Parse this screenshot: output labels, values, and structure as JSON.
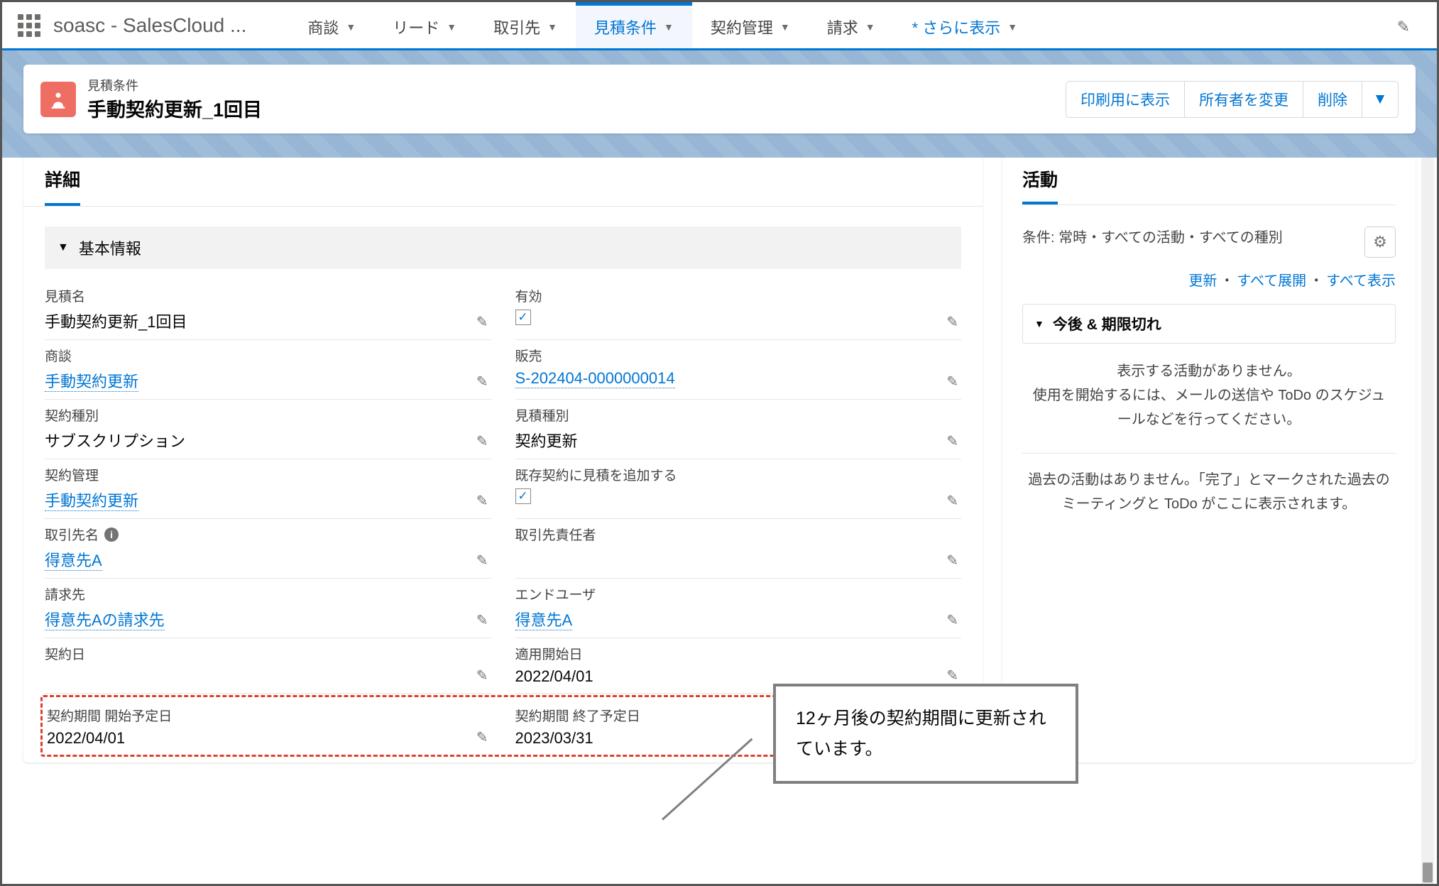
{
  "nav": {
    "app_name": "soasc - SalesCloud ...",
    "items": [
      {
        "label": "商談"
      },
      {
        "label": "リード"
      },
      {
        "label": "取引先"
      },
      {
        "label": "見積条件"
      },
      {
        "label": "契約管理"
      },
      {
        "label": "請求"
      }
    ],
    "more": "* さらに表示"
  },
  "header": {
    "object_label": "見積条件",
    "title": "手動契約更新_1回目",
    "actions": {
      "print": "印刷用に表示",
      "owner": "所有者を変更",
      "delete": "削除"
    }
  },
  "detail": {
    "tab": "詳細",
    "section_basic": "基本情報",
    "fields": {
      "name_label": "見積名",
      "name_value": "手動契約更新_1回目",
      "valid_label": "有効",
      "opp_label": "商談",
      "opp_value": "手動契約更新",
      "sales_label": "販売",
      "sales_value": "S-202404-0000000014",
      "ctype_label": "契約種別",
      "ctype_value": "サブスクリプション",
      "qtype_label": "見積種別",
      "qtype_value": "契約更新",
      "cmgmt_label": "契約管理",
      "cmgmt_value": "手動契約更新",
      "addexist_label": "既存契約に見積を追加する",
      "acct_label": "取引先名",
      "acct_value": "得意先A",
      "contact_label": "取引先責任者",
      "bill_label": "請求先",
      "bill_value": "得意先Aの請求先",
      "enduser_label": "エンドユーザ",
      "enduser_value": "得意先A",
      "cdate_label": "契約日",
      "appstart_label": "適用開始日",
      "appstart_value": "2022/04/01",
      "pstart_label": "契約期間 開始予定日",
      "pstart_value": "2022/04/01",
      "pend_label": "契約期間 終了予定日",
      "pend_value": "2023/03/31"
    }
  },
  "activity": {
    "tab": "活動",
    "filter": "条件: 常時・すべての活動・すべての種別",
    "links": {
      "refresh": "更新",
      "expand": "すべて展開",
      "showall": "すべて表示"
    },
    "upcoming_sec": "今後 & 期限切れ",
    "no_upcoming_1": "表示する活動がありません。",
    "no_upcoming_2": "使用を開始するには、メールの送信や ToDo のスケジュールなどを行ってください。",
    "past": "過去の活動はありません。「完了」とマークされた過去のミーティングと ToDo がここに表示されます。"
  },
  "callout": "12ヶ月後の契約期間に更新されています。"
}
